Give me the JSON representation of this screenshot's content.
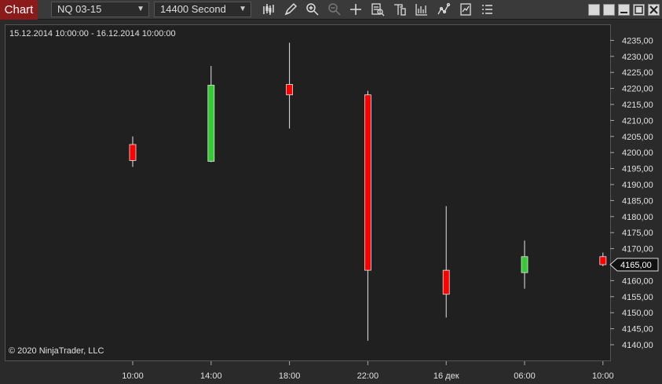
{
  "window": {
    "title": "Chart"
  },
  "toolbar": {
    "instrument": "NQ 03-15",
    "interval": "14400 Second",
    "tools": [
      "bar-style-icon",
      "draw-pencil-icon",
      "zoom-in-icon",
      "zoom-out-icon",
      "crosshair-icon",
      "data-box-icon",
      "properties-icon",
      "strategies-icon",
      "indicators-icon",
      "templates-icon",
      "list-icon"
    ]
  },
  "header": {
    "date_range": "15.12.2014 10:00:00 - 16.12.2014 10:00:00"
  },
  "footer": {
    "copyright": "© 2020 NinjaTrader, LLC"
  },
  "colors": {
    "up": "#33cc33",
    "down": "#ff0000",
    "background": "#202020"
  },
  "chart_data": {
    "type": "candlestick",
    "x_ticks": [
      "10:00",
      "14:00",
      "18:00",
      "22:00",
      "16 дек",
      "06:00",
      "10:00"
    ],
    "candles": [
      {
        "x": "10:00",
        "open": 4202.5,
        "high": 4205.0,
        "low": 4195.5,
        "close": 4197.5
      },
      {
        "x": "14:00",
        "open": 4197.25,
        "high": 4227.0,
        "low": 4197.0,
        "close": 4221.0
      },
      {
        "x": "18:00",
        "open": 4221.25,
        "high": 4234.25,
        "low": 4207.5,
        "close": 4218.0
      },
      {
        "x": "22:00",
        "open": 4218.0,
        "high": 4219.25,
        "low": 4141.25,
        "close": 4163.25
      },
      {
        "x": "16 дек",
        "open": 4163.25,
        "high": 4183.25,
        "low": 4148.5,
        "close": 4155.75
      },
      {
        "x": "06:00",
        "open": 4162.5,
        "high": 4172.5,
        "low": 4157.5,
        "close": 4167.5
      },
      {
        "x": "10:00",
        "open": 4167.5,
        "high": 4168.75,
        "low": 4164.5,
        "close": 4165.0
      }
    ],
    "y_ticks": [
      "4140,00",
      "4145,00",
      "4150,00",
      "4155,00",
      "4160,00",
      "4165,00",
      "4170,00",
      "4175,00",
      "4180,00",
      "4185,00",
      "4190,00",
      "4195,00",
      "4200,00",
      "4205,00",
      "4210,00",
      "4215,00",
      "4220,00",
      "4225,00",
      "4230,00",
      "4235,00"
    ],
    "ylim": [
      4137.5,
      4238.0
    ],
    "last_price": "4165,00"
  }
}
